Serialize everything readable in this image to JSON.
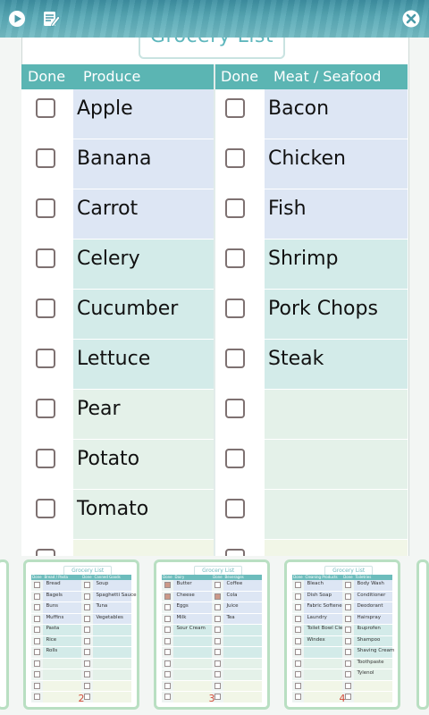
{
  "toolbar": {
    "left_icons": [
      "play-icon",
      "edit-list-icon"
    ],
    "right_icon": "close-icon"
  },
  "list": {
    "title": "Grocery List",
    "columns": [
      {
        "done_label": "Done",
        "category": "Produce"
      },
      {
        "done_label": "Done",
        "category": "Meat / Seafood"
      }
    ],
    "rows": [
      {
        "left": "Apple",
        "right": "Bacon"
      },
      {
        "left": "Banana",
        "right": "Chicken"
      },
      {
        "left": "Carrot",
        "right": "Fish"
      },
      {
        "left": "Celery",
        "right": "Shrimp"
      },
      {
        "left": "Cucumber",
        "right": "Pork Chops"
      },
      {
        "left": "Lettuce",
        "right": "Steak"
      },
      {
        "left": "Pear",
        "right": ""
      },
      {
        "left": "Potato",
        "right": ""
      },
      {
        "left": "Tomato",
        "right": ""
      },
      {
        "left": "",
        "right": ""
      }
    ]
  },
  "colors": {
    "header": "#5bb5b3",
    "row_blue": "#dde6f4",
    "row_teal": "#d3ebe9",
    "row_green": "#e4f1e9",
    "row_yellow": "#f1f6e7",
    "thumb_border": "#b9dfc2",
    "page_number": "#d34b3a"
  },
  "thumbnails": [
    {
      "page": "2",
      "title": "Grocery List",
      "headers": [
        "Done",
        "Bread / Pasta",
        "Done",
        "Canned Goods"
      ],
      "rows": [
        {
          "left": "Bread",
          "right": "Soup",
          "lc": false,
          "rc": false
        },
        {
          "left": "Bagels",
          "right": "Spaghetti Sauce",
          "lc": false,
          "rc": false
        },
        {
          "left": "Buns",
          "right": "Tuna",
          "lc": false,
          "rc": false
        },
        {
          "left": "Muffins",
          "right": "Vegetables",
          "lc": false,
          "rc": false
        },
        {
          "left": "Pasta",
          "right": "",
          "lc": false,
          "rc": false
        },
        {
          "left": "Rice",
          "right": "",
          "lc": false,
          "rc": false
        },
        {
          "left": "Rolls",
          "right": "",
          "lc": false,
          "rc": false
        },
        {
          "left": "",
          "right": "",
          "lc": false,
          "rc": false
        },
        {
          "left": "",
          "right": "",
          "lc": false,
          "rc": false
        },
        {
          "left": "",
          "right": "",
          "lc": false,
          "rc": false
        },
        {
          "left": "",
          "right": "",
          "lc": false,
          "rc": false
        }
      ]
    },
    {
      "page": "3",
      "title": "Grocery List",
      "headers": [
        "Done",
        "Dairy",
        "Done",
        "Beverages"
      ],
      "rows": [
        {
          "left": "Butter",
          "right": "Coffee",
          "lc": true,
          "rc": false
        },
        {
          "left": "Cheese",
          "right": "Cola",
          "lc": true,
          "rc": true
        },
        {
          "left": "Eggs",
          "right": "Juice",
          "lc": false,
          "rc": false
        },
        {
          "left": "Milk",
          "right": "Tea",
          "lc": false,
          "rc": false
        },
        {
          "left": "Sour Cream",
          "right": "",
          "lc": false,
          "rc": false
        },
        {
          "left": "",
          "right": "",
          "lc": false,
          "rc": false
        },
        {
          "left": "",
          "right": "",
          "lc": false,
          "rc": false
        },
        {
          "left": "",
          "right": "",
          "lc": false,
          "rc": false
        },
        {
          "left": "",
          "right": "",
          "lc": false,
          "rc": false
        },
        {
          "left": "",
          "right": "",
          "lc": false,
          "rc": false
        },
        {
          "left": "",
          "right": "",
          "lc": false,
          "rc": false
        }
      ]
    },
    {
      "page": "4",
      "title": "Grocery List",
      "headers": [
        "Done",
        "Cleaning Products",
        "Done",
        "Toiletries"
      ],
      "rows": [
        {
          "left": "Bleach",
          "right": "Body Wash",
          "lc": false,
          "rc": false
        },
        {
          "left": "Dish Soap",
          "right": "Conditioner",
          "lc": false,
          "rc": false
        },
        {
          "left": "Fabric Softener",
          "right": "Deodorant",
          "lc": false,
          "rc": false
        },
        {
          "left": "Laundry",
          "right": "Hairspray",
          "lc": false,
          "rc": false
        },
        {
          "left": "Toilet Bowl Cleaner",
          "right": "Ibuprofen",
          "lc": false,
          "rc": false
        },
        {
          "left": "Windex",
          "right": "Shampoo",
          "lc": false,
          "rc": false
        },
        {
          "left": "",
          "right": "Shaving Cream",
          "lc": false,
          "rc": false
        },
        {
          "left": "",
          "right": "Toothpaste",
          "lc": false,
          "rc": false
        },
        {
          "left": "",
          "right": "Tylenol",
          "lc": false,
          "rc": false
        },
        {
          "left": "",
          "right": "",
          "lc": false,
          "rc": false
        },
        {
          "left": "",
          "right": "",
          "lc": false,
          "rc": false
        }
      ]
    }
  ]
}
